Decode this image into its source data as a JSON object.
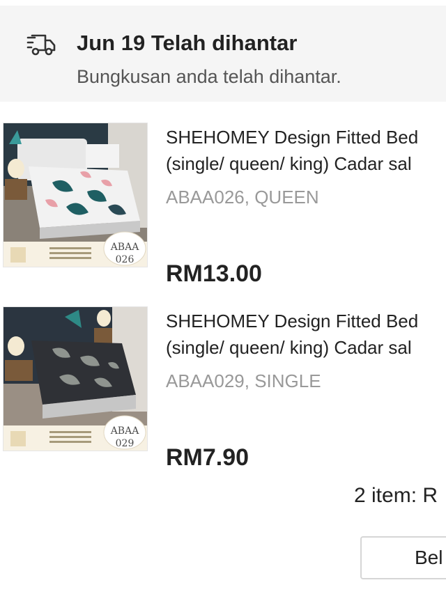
{
  "delivery_status": {
    "title": "Jun 19 Telah dihantar",
    "subtitle": "Bungkusan anda telah dihantar.",
    "icon": "delivery-truck-icon"
  },
  "order_items": [
    {
      "title_line_1": "SHEHOMEY Design Fitted Bed",
      "title_line_2": "(single/ queen/ king) Cadar sal",
      "variant": "ABAA026, QUEEN",
      "price": "RM13.00",
      "image_code": "ABAA 026",
      "image_code_line_1": "ABAA",
      "image_code_line_2": "026",
      "sheet_color": "#f2f2f2"
    },
    {
      "title_line_1": "SHEHOMEY Design Fitted Bed",
      "title_line_2": "(single/ queen/ king) Cadar sal",
      "variant": "ABAA029, SINGLE",
      "price": "RM7.90",
      "image_code": "ABAA 029",
      "image_code_line_1": "ABAA",
      "image_code_line_2": "029",
      "sheet_color": "#2f3136"
    }
  ],
  "summary": {
    "text": "2 item: R"
  },
  "action_button": {
    "label": "Bel"
  }
}
